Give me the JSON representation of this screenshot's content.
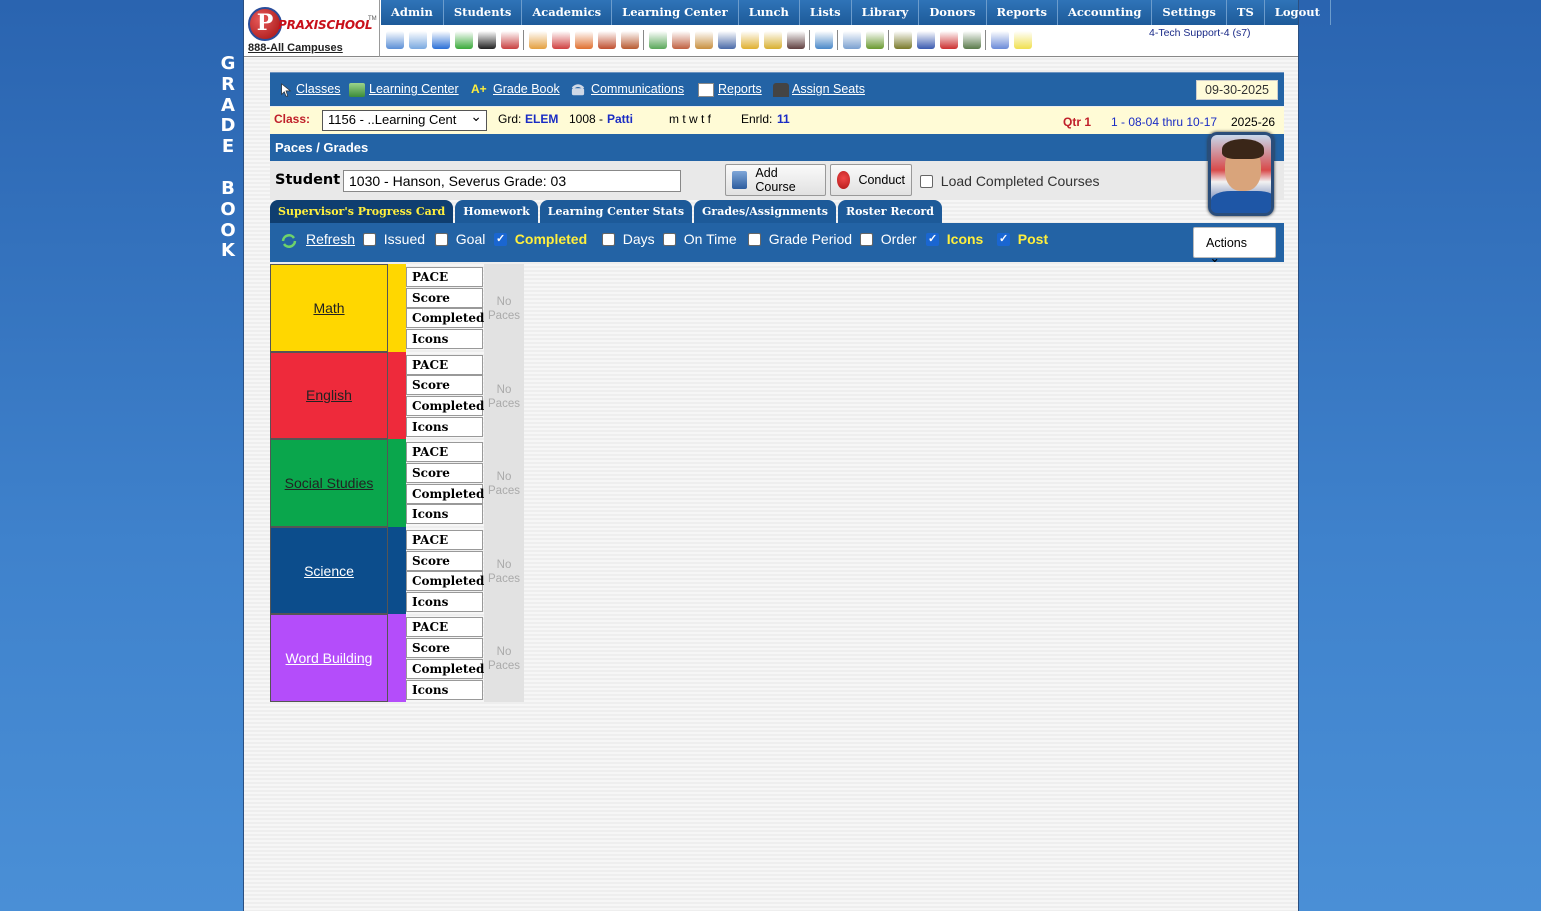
{
  "vertical_title": [
    "G",
    "R",
    "A",
    "D",
    "E",
    "",
    "B",
    "O",
    "O",
    "K"
  ],
  "logo": {
    "letter": "P",
    "name": "PRAXISCHOOL",
    "tm": "TM",
    "campus": "888-All Campuses"
  },
  "menu": [
    "Admin",
    "Students",
    "Academics",
    "Learning Center",
    "Lunch",
    "Lists",
    "Library",
    "Donors",
    "Reports",
    "Accounting",
    "Settings",
    "TS",
    "Logout"
  ],
  "support_text": "4-Tech Support-4 (s7)",
  "toolbar_icons": [
    "search-icon",
    "calendar-grid-icon",
    "email-icon",
    "chat-icon",
    "mobile-icon",
    "megaphone-icon",
    "schedule-icon",
    "calendar-icon",
    "announce-icon",
    "teacher-icon",
    "staff-icon",
    "money-icon",
    "family-icon",
    "lunch-icon",
    "book-icon",
    "broom-icon",
    "forward-icon",
    "parent-icon",
    "clock-icon",
    "list-icon",
    "barcode-icon",
    "printer-icon",
    "ap-icon",
    "pdf-icon",
    "cash-icon",
    "help-icon",
    "note-icon"
  ],
  "nav": {
    "classes": "Classes",
    "learning_center": "Learning Center",
    "grade_book": "Grade Book",
    "communications": "Communications",
    "reports": "Reports",
    "assign_seats": "Assign Seats",
    "date": "09-30-2025"
  },
  "class_info": {
    "label": "Class:",
    "selected": "1156 - ..Learning Cent",
    "grd_label": "Grd:",
    "grd": "ELEM",
    "teacher_id": "1008 -",
    "teacher": "Patti",
    "days": "m t w t f",
    "enrld_label": "Enrld:",
    "enrld": "11",
    "qtr": "Qtr 1",
    "range": "1 - 08-04 thru 10-17",
    "year": "2025-26"
  },
  "section_title": "Paces / Grades",
  "student": {
    "label": "Student",
    "value": "1030 - Hanson, Severus Grade: 03",
    "add_course": "Add Course",
    "conduct": "Conduct",
    "load_completed": "Load Completed Courses"
  },
  "tabs": [
    "Supervisor's Progress Card",
    "Homework",
    "Learning Center Stats",
    "Grades/Assignments",
    "Roster Record"
  ],
  "filters": {
    "refresh": "Refresh",
    "issued": "Issued",
    "goal": "Goal",
    "completed": "Completed",
    "days": "Days",
    "on_time": "On Time",
    "grade_period": "Grade Period",
    "order": "Order",
    "icons": "Icons",
    "post": "Post",
    "actions": "Actions"
  },
  "row_labels": [
    "PACE",
    "Score",
    "Completed",
    "Icons"
  ],
  "no_paces": [
    "No",
    "Paces"
  ],
  "subjects": [
    {
      "name": "Math",
      "color": "#ffd700",
      "text": "#222"
    },
    {
      "name": "English",
      "color": "#ee2a3b",
      "text": "#222"
    },
    {
      "name": "Social Studies",
      "color": "#0aa64c",
      "text": "#222"
    },
    {
      "name": "Science",
      "color": "#0c4d8c",
      "text": "#ffffff"
    },
    {
      "name": "Word Building",
      "color": "#b44dfa",
      "text": "#ffffff"
    }
  ]
}
